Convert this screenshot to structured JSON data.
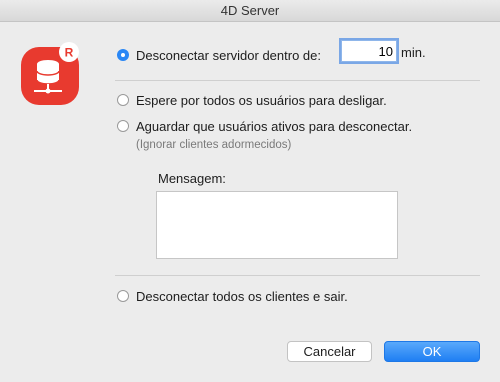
{
  "window": {
    "title": "4D Server"
  },
  "icon": {
    "name": "server-database-icon",
    "badge": "R",
    "color": "#e83a2f"
  },
  "options": {
    "disconnect_within": {
      "label": "Desconectar servidor dentro de:",
      "value": "10",
      "unit": "min.",
      "selected": true
    },
    "wait_all": {
      "label": "Espere por todos os usuários para desligar.",
      "selected": false
    },
    "wait_active": {
      "label": "Aguardar que usuários ativos para desconectar.",
      "hint": "(Ignorar clientes adormecidos)",
      "selected": false
    },
    "message": {
      "label": "Mensagem:",
      "value": ""
    },
    "disconnect_all": {
      "label": "Desconectar todos os clientes e sair.",
      "selected": false
    }
  },
  "buttons": {
    "cancel": "Cancelar",
    "ok": "OK"
  },
  "colors": {
    "accent": "#2a87f5",
    "icon_red": "#e83a2f"
  }
}
